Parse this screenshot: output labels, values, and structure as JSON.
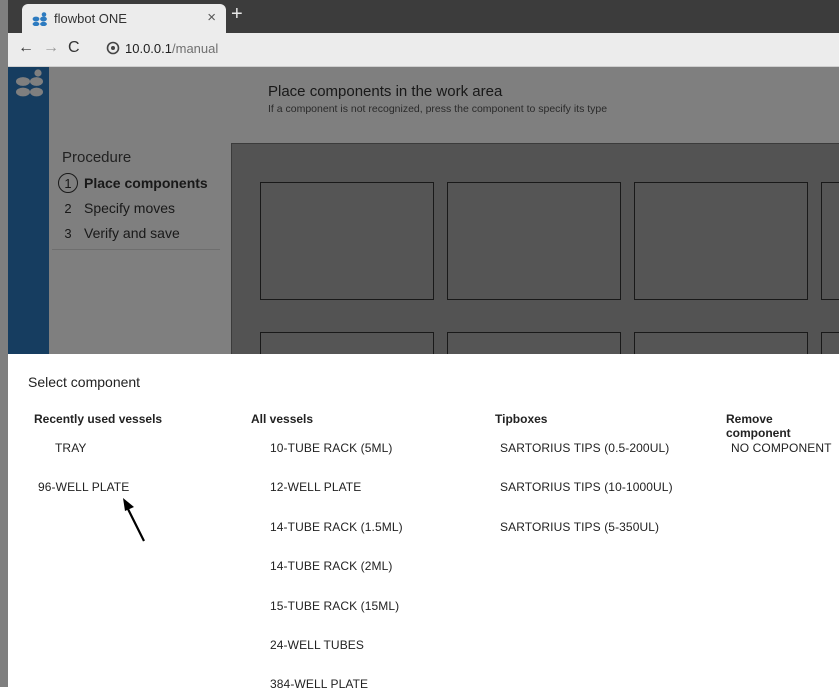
{
  "browser": {
    "tab_title": "flowbot ONE",
    "tab_close": "×",
    "new_tab": "+",
    "nav_back": "←",
    "nav_forward": "→",
    "nav_reload": "C",
    "url_host": "10.0.0.1",
    "url_path": "/manual"
  },
  "header": {
    "title": "Place components in the work area",
    "subtitle": "If a component is not recognized, press the component to specify its type"
  },
  "procedure": {
    "title": "Procedure",
    "steps": [
      {
        "num": "1",
        "label": "Place components"
      },
      {
        "num": "2",
        "label": "Specify moves"
      },
      {
        "num": "3",
        "label": "Verify and save"
      }
    ],
    "active_step": 1
  },
  "sheet": {
    "title": "Select component",
    "columns": [
      {
        "header": "Recently used vessels",
        "items": [
          "TRAY",
          "96-WELL PLATE"
        ]
      },
      {
        "header": "All vessels",
        "items": [
          "10-TUBE RACK (5ML)",
          "12-WELL PLATE",
          "14-TUBE RACK (1.5ML)",
          "14-TUBE RACK (2ML)",
          "15-TUBE RACK (15ML)",
          "24-WELL TUBES",
          "384-WELL PLATE"
        ]
      },
      {
        "header": "Tipboxes",
        "items": [
          "SARTORIUS TIPS (0.5-200UL)",
          "SARTORIUS TIPS (10-1000UL)",
          "SARTORIUS TIPS (5-350UL)"
        ]
      },
      {
        "header": "Remove component",
        "items": [
          "NO COMPONENT"
        ]
      }
    ]
  },
  "colors": {
    "rail": "#2d7bc0",
    "logo": "#2d7bc0",
    "overlay": "rgba(0,0,0,0.5)"
  },
  "icons": [
    "flowbot-logo-icon",
    "globe-icon",
    "back-arrow-icon",
    "forward-arrow-icon",
    "reload-icon",
    "close-icon",
    "plus-icon",
    "cursor-arrow-icon"
  ]
}
